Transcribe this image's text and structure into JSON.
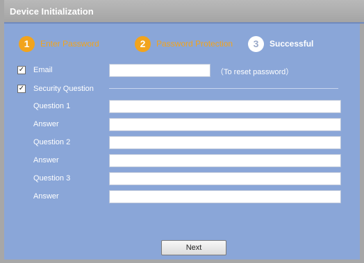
{
  "window": {
    "title": "Device Initialization"
  },
  "steps": [
    {
      "num": "1",
      "label": "Enter Password",
      "state": "done"
    },
    {
      "num": "2",
      "label": "Password Protection",
      "state": "done"
    },
    {
      "num": "3",
      "label": "Successful",
      "state": "current"
    }
  ],
  "form": {
    "email": {
      "label": "Email",
      "checked": true,
      "value": "",
      "hint": "（To reset password）"
    },
    "security": {
      "label": "Security Question",
      "checked": true
    },
    "rows": [
      {
        "label": "Question 1",
        "value": ""
      },
      {
        "label": "Answer",
        "value": ""
      },
      {
        "label": "Question 2",
        "value": ""
      },
      {
        "label": "Answer",
        "value": ""
      },
      {
        "label": "Question 3",
        "value": ""
      },
      {
        "label": "Answer",
        "value": ""
      }
    ]
  },
  "buttons": {
    "next_label": "Next"
  },
  "colors": {
    "background": "#8aa6d8",
    "accent": "#f2a41d",
    "titlebar": "#a7a7a7"
  }
}
